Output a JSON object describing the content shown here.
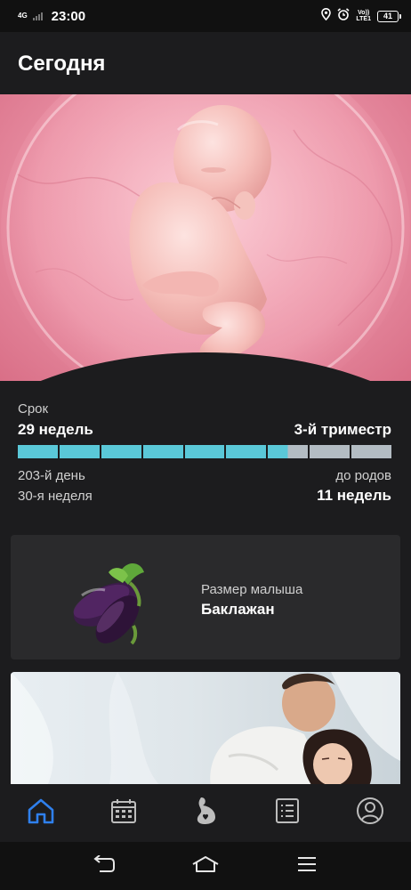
{
  "status_bar": {
    "network": "4G",
    "time": "23:00",
    "volte_top": "Vo))",
    "volte_bottom": "LTE1",
    "battery": "41"
  },
  "header": {
    "title": "Сегодня"
  },
  "pregnancy": {
    "term_label": "Срок",
    "weeks": "29 недель",
    "trimester": "3-й триместр",
    "progress_segments_total": 9,
    "progress_segments_filled": 6.5,
    "day": "203-й день",
    "week_number": "30-я неделя",
    "until_birth_label": "до родов",
    "weeks_remaining": "11 недель",
    "progress_color": "#5ac8d8",
    "track_color": "#b3bcc3"
  },
  "baby_size": {
    "label": "Размер малыша",
    "value": "Баклажан",
    "icon": "eggplant-icon"
  },
  "tabs": [
    {
      "icon": "home-icon",
      "active": true
    },
    {
      "icon": "calendar-icon",
      "active": false
    },
    {
      "icon": "pregnant-belly-icon",
      "active": false
    },
    {
      "icon": "checklist-icon",
      "active": false
    },
    {
      "icon": "profile-icon",
      "active": false
    }
  ],
  "accent_color": "#2f80ed",
  "system_nav": [
    "back-icon",
    "home-icon",
    "menu-icon"
  ]
}
